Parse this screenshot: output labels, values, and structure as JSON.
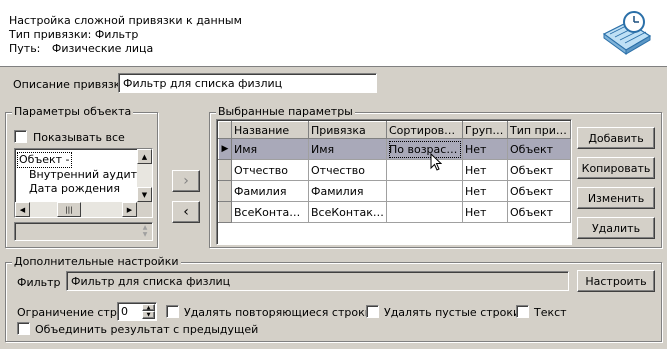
{
  "header": {
    "title": "Настройка сложной привязки к данным",
    "type_line": "Тип привязки: Фильтр",
    "path_label": "Путь:",
    "path_value": "Физические лица",
    "icon": "calendar-clock-icon"
  },
  "description": {
    "label": "Описание привязки",
    "value": "Фильтр для списка физлиц"
  },
  "object_params": {
    "legend": "Параметры объекта",
    "show_all_label": "Показывать все",
    "tree_items": [
      "Объект -",
      "Внутренний аудитор",
      "Дата рождения",
      "..."
    ]
  },
  "selected_params": {
    "legend": "Выбранные параметры",
    "columns": [
      "Название",
      "Привязка",
      "Сортировать",
      "Групп...",
      "Тип прив..."
    ],
    "rows": [
      [
        "Имя",
        "Имя",
        "По возраст...",
        "Нет",
        "Объект"
      ],
      [
        "Отчество",
        "Отчество",
        "",
        "Нет",
        "Объект"
      ],
      [
        "Фамилия",
        "Фамилия",
        "",
        "Нет",
        "Объект"
      ],
      [
        "ВсеКонтакты",
        "ВсеКонтакты",
        "",
        "Нет",
        "Объект"
      ]
    ],
    "current_row_marker": "▶"
  },
  "side_buttons": {
    "add": "Добавить",
    "copy": "Копировать",
    "edit": "Изменить",
    "delete": "Удалить"
  },
  "move": {
    "right": "›",
    "left": "‹"
  },
  "extra": {
    "legend": "Дополнительные настройки",
    "filter_label": "Фильтр",
    "filter_value": "Фильтр для списка физлиц",
    "configure_button": "Настроить",
    "row_limit_label": "Ограничение строк",
    "row_limit_value": "0",
    "remove_duplicates_label": "Удалять повторяющиеся строки",
    "remove_empty_label": "Удалять пустые строки",
    "text_label": "Текст",
    "merge_label": "Объединить результат с предыдущей"
  },
  "colors": {
    "face": "#d4d0c8",
    "selected_row": "#a9a9b9",
    "header_bg": "#ffffff"
  }
}
